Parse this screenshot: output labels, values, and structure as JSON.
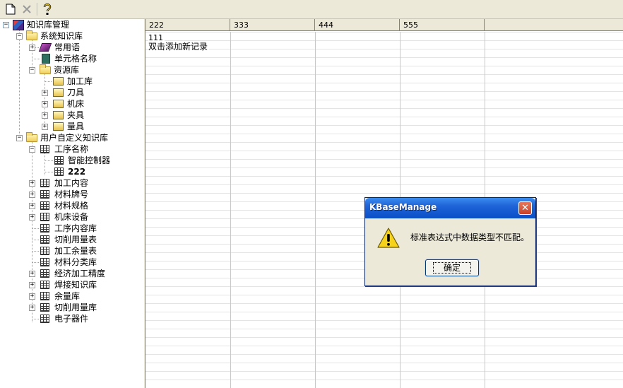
{
  "toolbar": {
    "icons": [
      "new-document-icon",
      "delete-icon",
      "help-icon"
    ]
  },
  "tree": {
    "root": "知识库管理",
    "system_kb": "系统知识库",
    "common_phrases": "常用语",
    "cell_format_name": "单元格名称",
    "resource_lib": "资源库",
    "processing_lib": "加工库",
    "tools": "刀具",
    "machine": "机床",
    "fixture": "夹具",
    "gauge": "量具",
    "user_kb": "用户自定义知识库",
    "process_name": "工序名称",
    "smart_controller": "智能控制器",
    "item_222": "222",
    "processing_content": "加工内容",
    "material_grade": "材料牌号",
    "material_spec": "材料规格",
    "machine_equipment": "机床设备",
    "process_content_lib": "工序内容库",
    "cutting_amount_table": "切削用量表",
    "machining_allowance_table": "加工余量表",
    "material_classification": "材料分类库",
    "economic_precision": "经济加工精度",
    "welding_kb": "焊接知识库",
    "allowance_lib": "余量库",
    "cutting_amount_lib": "切削用量库",
    "electronic_devices": "电子器件"
  },
  "grid": {
    "columns": [
      "222",
      "333",
      "444",
      "555"
    ],
    "row1": "111",
    "add_record_hint": "双击添加新记录"
  },
  "dialog": {
    "title": "KBaseManage",
    "message": "标准表达式中数据类型不匹配。",
    "ok_label": "确定",
    "close_symbol": "✕"
  }
}
